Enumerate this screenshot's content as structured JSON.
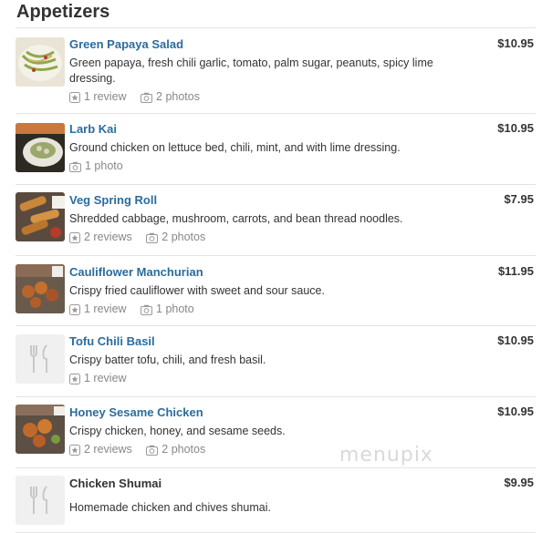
{
  "section": {
    "title": "Appetizers"
  },
  "items": [
    {
      "name": "Green Papaya Salad",
      "price": "$10.95",
      "description": "Green papaya, fresh chili garlic, tomato, palm sugar, peanuts, spicy lime dressing.",
      "reviews": "1 review",
      "photos": "2 photos",
      "thumb": "photo-papaya-salad"
    },
    {
      "name": "Larb Kai",
      "price": "$10.95",
      "description": "Ground chicken on lettuce bed, chili, mint, and with lime dressing.",
      "photos": "1 photo",
      "thumb": "photo-larb-kai"
    },
    {
      "name": "Veg Spring Roll",
      "price": "$7.95",
      "description": "Shredded cabbage, mushroom, carrots, and bean thread noodles.",
      "reviews": "2 reviews",
      "photos": "2 photos",
      "thumb": "photo-spring-roll"
    },
    {
      "name": "Cauliflower Manchurian",
      "price": "$11.95",
      "description": "Crispy fried cauliflower with sweet and sour sauce.",
      "reviews": "1 review",
      "photos": "1 photo",
      "thumb": "photo-cauliflower"
    },
    {
      "name": "Tofu Chili Basil",
      "price": "$10.95",
      "description": "Crispy batter tofu, chili, and fresh basil.",
      "reviews": "1 review",
      "thumb": "placeholder-utensils-icon"
    },
    {
      "name": "Honey Sesame Chicken",
      "price": "$10.95",
      "description": "Crispy chicken, honey, and sesame seeds.",
      "reviews": "2 reviews",
      "photos": "2 photos",
      "thumb": "photo-honey-chicken"
    },
    {
      "name": "Chicken Shumai",
      "price": "$9.95",
      "description": "Homemade chicken and chives shumai.",
      "thumb": "placeholder-utensils-icon"
    }
  ],
  "watermark": "menupix",
  "colors": {
    "link": "#2a6c9e",
    "meta": "#888888",
    "divider": "#e3e3e3"
  }
}
